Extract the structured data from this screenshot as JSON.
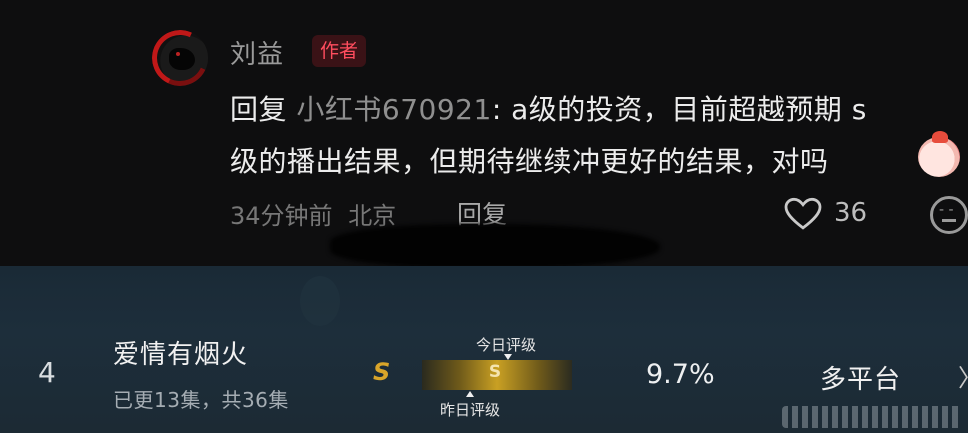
{
  "comment": {
    "author": "刘益",
    "author_badge": "作者",
    "reply_prefix": "回复",
    "reply_to": "小红书670921",
    "line1_text": ": a级的投资，目前超越预期 s",
    "line2_text": "级的播出结果，但期待继续冲更好的结果，对吗",
    "time": "34分钟前",
    "location": "北京",
    "reply_button": "回复",
    "like_count": "36",
    "icons": [
      "avatar",
      "heart-icon",
      "emoji-reply-icon",
      "blushing-emoji"
    ]
  },
  "ranking": {
    "rank": "4",
    "title": "爱情有烟火",
    "episodes": "已更13集，共36集",
    "yesterday_grade_mark": "S",
    "bar_grade": "S",
    "today_label": "今日评级",
    "yesterday_label": "昨日评级",
    "share": "9.7%",
    "platform": "多平台",
    "chevron": "〉"
  },
  "colors": {
    "author_badge": "#ff4d5e",
    "grade_gold": "#d9a52a",
    "row_background": "#1c2c38"
  }
}
